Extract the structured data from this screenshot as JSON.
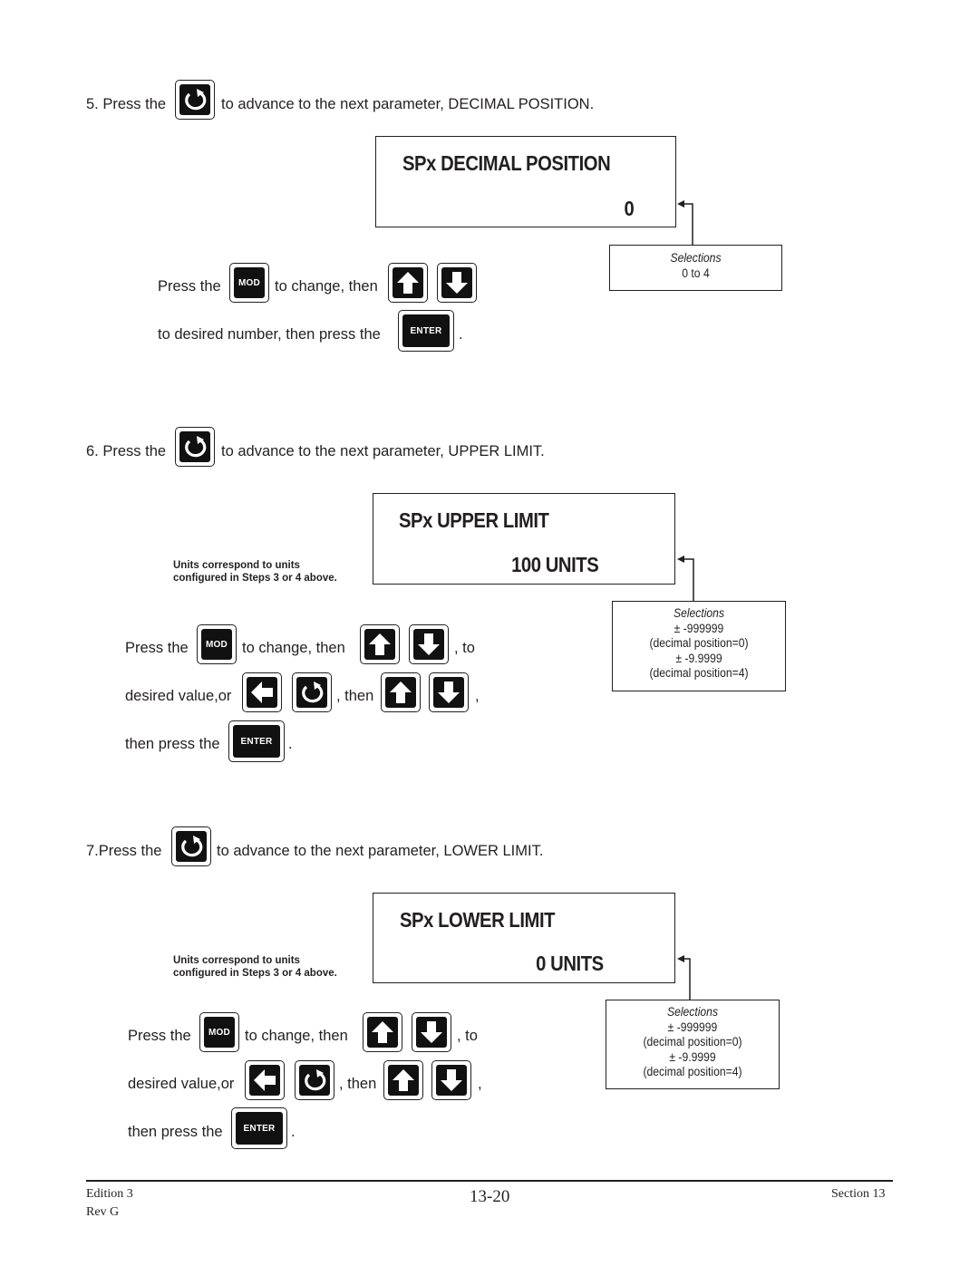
{
  "icons": {
    "advance": "circular-arrow-key",
    "mod": "MOD",
    "up": "up-arrow-key",
    "down": "down-arrow-key",
    "left": "left-arrow-key",
    "enter": "ENTER"
  },
  "step5": {
    "lead": "5. Press the",
    "trail": "to advance to the next parameter, DECIMAL POSITION.",
    "display": {
      "title": "SPx DECIMAL POSITION",
      "value": "0"
    },
    "selections": {
      "heading": "Selections",
      "lines": [
        "0 to 4"
      ]
    },
    "instr_line1_a": "Press the",
    "instr_line1_b": "to change, then",
    "instr_line2_a": "to desired number, then press the",
    "instr_line2_b": "."
  },
  "step6": {
    "lead": "6. Press the",
    "trail": "to advance to the next parameter, UPPER LIMIT.",
    "display": {
      "title": "SPx UPPER LIMIT",
      "value": "100 UNITS"
    },
    "note": [
      "Units correspond to units",
      "configured in Steps 3 or 4 above."
    ],
    "selections": {
      "heading": "Selections",
      "lines": [
        "± -999999",
        "(decimal position=0)",
        "± -9.9999",
        "(decimal position=4)"
      ]
    },
    "instr_line1_a": "Press the",
    "instr_line1_b": "to change, then",
    "instr_line1_c": ", to",
    "instr_line2_a": "desired value,or",
    "instr_line2_b": ", then",
    "instr_line2_c": ",",
    "instr_line3_a": "then press the",
    "instr_line3_b": "."
  },
  "step7": {
    "lead": "7.Press the",
    "trail": "to advance to the next parameter, LOWER LIMIT.",
    "display": {
      "title": "SPx LOWER LIMIT",
      "value": "0 UNITS"
    },
    "note": [
      "Units correspond to units",
      "configured in Steps 3 or 4 above."
    ],
    "selections": {
      "heading": "Selections",
      "lines": [
        "± -999999",
        "(decimal position=0)",
        "± -9.9999",
        "(decimal position=4)"
      ]
    },
    "instr_line1_a": "Press the",
    "instr_line1_b": "to change, then",
    "instr_line1_c": ", to",
    "instr_line2_a": "desired value,or",
    "instr_line2_b": ", then",
    "instr_line2_c": ",",
    "instr_line3_a": "then press the",
    "instr_line3_b": "."
  },
  "footer": {
    "edition": "Edition 3",
    "rev": "Rev G",
    "page": "13-20",
    "section": "Section 13"
  }
}
